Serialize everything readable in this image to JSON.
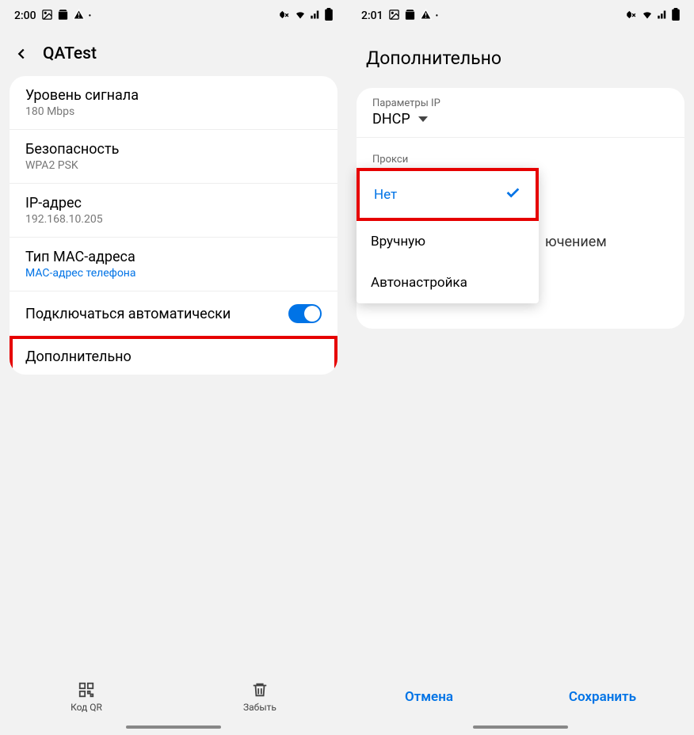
{
  "left": {
    "status": {
      "time": "2:00",
      "icons_left": [
        "image-icon",
        "bag-icon",
        "warning-icon",
        "dot-icon"
      ],
      "icons_right": [
        "mute-icon",
        "wifi-icon",
        "signal-icon",
        "battery-icon"
      ]
    },
    "header_title": "QATest",
    "rows": [
      {
        "title": "Уровень сигнала",
        "subtitle": "180 Mbps"
      },
      {
        "title": "Безопасность",
        "subtitle": "WPA2 PSK"
      },
      {
        "title": "IP-адрес",
        "subtitle": "192.168.10.205"
      },
      {
        "title": "Тип MAC-адреса",
        "link": "MAC-адрес телефона"
      }
    ],
    "auto_connect_label": "Подключаться автоматически",
    "auto_connect_value": true,
    "advanced_label": "Дополнительно",
    "bottom": {
      "qr_label": "Код QR",
      "forget_label": "Забыть"
    }
  },
  "right": {
    "status": {
      "time": "2:01",
      "icons_left": [
        "image-icon",
        "bag-icon",
        "warning-icon",
        "dot-icon"
      ],
      "icons_right": [
        "mute-icon",
        "wifi-icon",
        "signal-icon",
        "battery-icon"
      ]
    },
    "header_title": "Дополнительно",
    "ip_params_label": "Параметры IP",
    "ip_params_value": "DHCP",
    "proxy_label": "Прокси",
    "proxy_options": [
      {
        "label": "Нет",
        "selected": true
      },
      {
        "label": "Вручную",
        "selected": false
      },
      {
        "label": "Автонастройка",
        "selected": false
      }
    ],
    "peek_text": "ючением",
    "footer": {
      "cancel": "Отмена",
      "save": "Сохранить"
    }
  }
}
